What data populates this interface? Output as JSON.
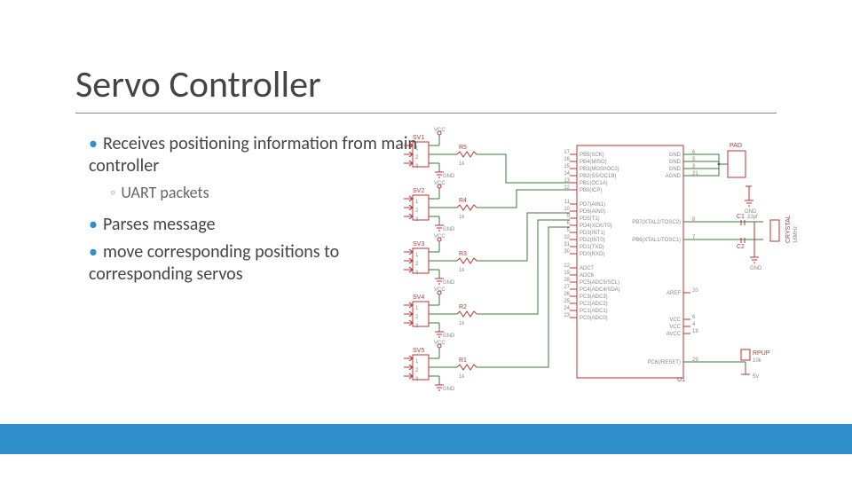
{
  "title": "Servo Controller",
  "bullets": {
    "b1": "Receives positioning information from main controller",
    "b2": "UART packets",
    "b3": "Parses message",
    "b4": "move corresponding positions to corresponding servos"
  },
  "schematic": {
    "sv_headers": [
      {
        "ref": "SV1",
        "r_ref": "R5",
        "r_val": "1k",
        "vcc": "VCC",
        "gnd": "GND"
      },
      {
        "ref": "SV2",
        "r_ref": "R4",
        "r_val": "1k",
        "vcc": "VCC",
        "gnd": "GND"
      },
      {
        "ref": "SV3",
        "r_ref": "R3",
        "r_val": "1k",
        "vcc": "VCC",
        "gnd": "GND"
      },
      {
        "ref": "SV4",
        "r_ref": "R2",
        "r_val": "1k",
        "vcc": "VCC",
        "gnd": "GND"
      },
      {
        "ref": "SV5",
        "r_ref": "R1",
        "r_val": "1k",
        "vcc": "VCC",
        "gnd": "GND"
      }
    ],
    "mcu": {
      "ref": "U1",
      "left_pins_a": [
        {
          "num": "17",
          "name": "PB5(SCK)"
        },
        {
          "num": "16",
          "name": "PB4(MISO)"
        },
        {
          "num": "15",
          "name": "PB3(MOSI/OC2)"
        },
        {
          "num": "14",
          "name": "PB2(SS/OC1B)"
        },
        {
          "num": "13",
          "name": "PB1(OC1A)"
        },
        {
          "num": "12",
          "name": "PB0(ICP)"
        }
      ],
      "left_pins_b": [
        {
          "num": "11",
          "name": "PD7(AIN1)"
        },
        {
          "num": "10",
          "name": "PD6(AIN0)"
        },
        {
          "num": "9",
          "name": "PD5(T1)"
        },
        {
          "num": "6",
          "name": "PD4(XCK/T0)"
        },
        {
          "num": "5",
          "name": "PD3(INT1)"
        },
        {
          "num": "32",
          "name": "PD2(INT0)"
        },
        {
          "num": "31",
          "name": "PD1(TXD)"
        },
        {
          "num": "30",
          "name": "PD0(RXD)"
        }
      ],
      "left_pins_c": [
        {
          "num": "22",
          "name": "ADC7"
        },
        {
          "num": "19",
          "name": "ADC6"
        },
        {
          "num": "28",
          "name": "PC5(ADC5/SCL)"
        },
        {
          "num": "27",
          "name": "PC4(ADC4/SDA)"
        },
        {
          "num": "26",
          "name": "PC3(ADC3)"
        },
        {
          "num": "25",
          "name": "PC2(ADC2)"
        },
        {
          "num": "24",
          "name": "PC1(ADC1)"
        },
        {
          "num": "23",
          "name": "PC0(ADC0)"
        }
      ],
      "right_pins_top": [
        {
          "num": "6",
          "name": "GND"
        },
        {
          "num": "5",
          "name": "GND"
        },
        {
          "num": "3",
          "name": "GND"
        },
        {
          "num": "21",
          "name": "AGND"
        }
      ],
      "osc": [
        {
          "num": "8",
          "name": "PB7(XTAL2/TOSC2)"
        },
        {
          "num": "7",
          "name": "PB6(XTAL1/TOSC1)"
        }
      ],
      "aref": {
        "num": "20",
        "name": "AREF"
      },
      "vcc": [
        {
          "num": "6",
          "name": "VCC"
        },
        {
          "num": "4",
          "name": "VCC"
        },
        {
          "num": "18",
          "name": "AVCC"
        }
      ],
      "reset": {
        "num": "29",
        "name": "PC6(/RESET)"
      }
    },
    "pad": {
      "ref": "PAD",
      "gnd": "GND"
    },
    "crystal": {
      "ref": "CRYSTAL",
      "val": "16MHz",
      "c1": "C1",
      "c2": "C2",
      "c_val": "22pf",
      "gnd": "GND"
    },
    "pullup": {
      "ref": "RPUP",
      "val": "10k",
      "rail": "5V"
    }
  }
}
